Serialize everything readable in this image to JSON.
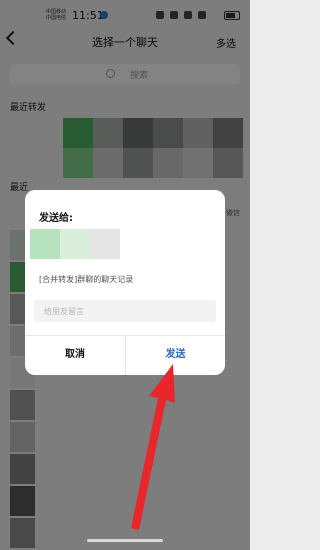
{
  "status_bar": {
    "carrier1": "中国移动",
    "carrier2": "中国电信",
    "time": "11:51"
  },
  "header": {
    "title": "选择一个聊天",
    "multi_select": "多选"
  },
  "search": {
    "placeholder": "搜索"
  },
  "recent_forward": {
    "label": "最近转发"
  },
  "recent_chats": {
    "label": "最近",
    "right_hint": "微信"
  },
  "dialog": {
    "title": "发送给:",
    "description": "[合并转发]群聊的聊天记录",
    "message_placeholder": "给朋友留言",
    "cancel_label": "取消",
    "send_label": "发送"
  },
  "colors": {
    "send": "#2d63b8",
    "arrow": "#e8262b",
    "overlay": "rgba(0,0,0,0.47)"
  }
}
